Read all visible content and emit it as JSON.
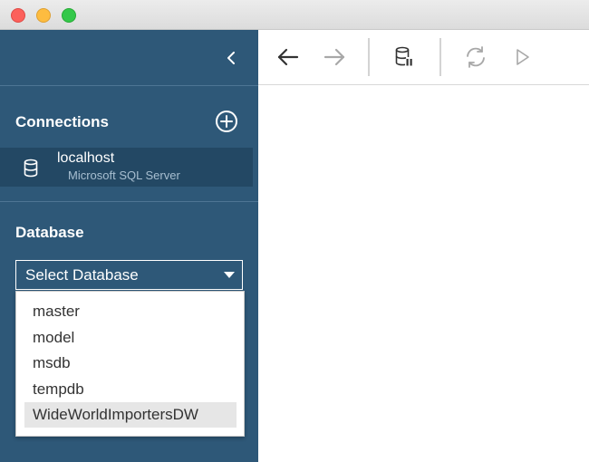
{
  "window": {
    "traffic_lights": {
      "close": "#fc605b",
      "minimize": "#fdbc40",
      "zoom": "#34c84a"
    }
  },
  "sidebar": {
    "background": "#2e5878",
    "collapse_icon": "chevron-left-icon",
    "connections": {
      "title": "Connections",
      "add_icon": "plus-circle-icon",
      "items": [
        {
          "name": "localhost",
          "type": "Microsoft SQL Server",
          "icon": "database-icon"
        }
      ]
    },
    "database": {
      "title": "Database",
      "selected": "Select Database",
      "options": [
        "master",
        "model",
        "msdb",
        "tempdb",
        "WideWorldImportersDW"
      ],
      "highlighted_option": "WideWorldImportersDW"
    }
  },
  "toolbar": {
    "buttons": [
      {
        "name": "back",
        "icon": "arrow-left-icon",
        "enabled": true
      },
      {
        "name": "forward",
        "icon": "arrow-right-icon",
        "enabled": false
      },
      {
        "name": "disconnect",
        "icon": "database-pause-icon",
        "enabled": true
      },
      {
        "name": "refresh",
        "icon": "refresh-icon",
        "enabled": false
      },
      {
        "name": "run",
        "icon": "play-icon",
        "enabled": false
      }
    ]
  }
}
